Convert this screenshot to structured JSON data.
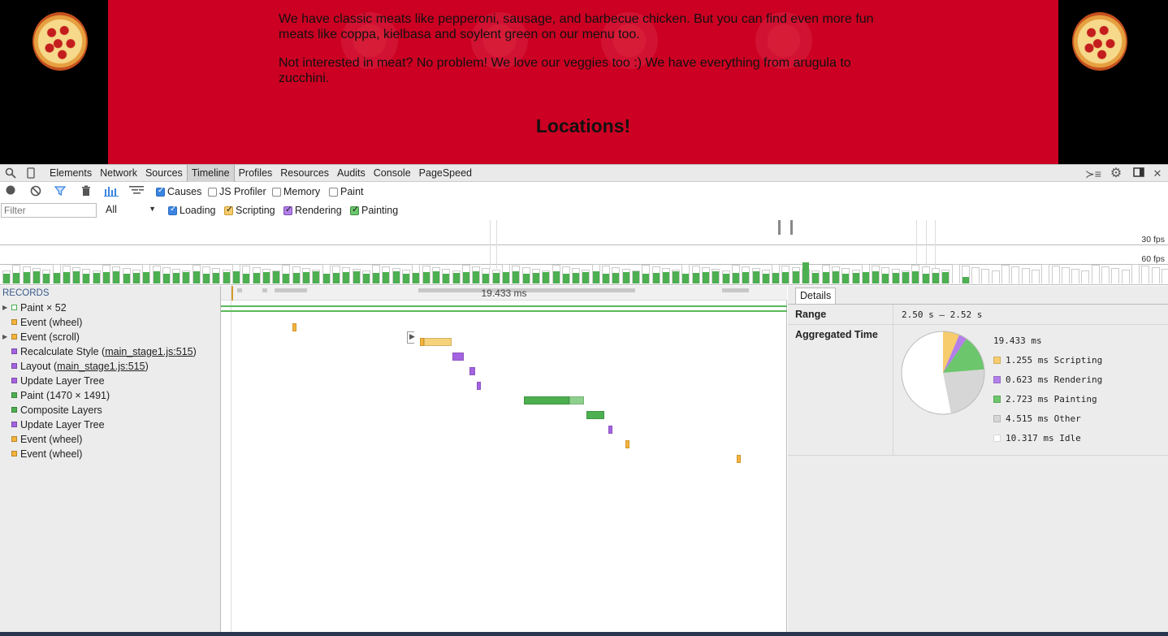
{
  "webpage": {
    "paragraph1": "We have classic meats like pepperoni, sausage, and barbecue chicken. But you can find even more fun meats like coppa, kielbasa and soylent green on our menu too.",
    "paragraph2": "Not interested in meat? No problem! We love our veggies too :) We have everything from arugula to zucchini.",
    "heading": "Locations!"
  },
  "devtools": {
    "tabs": [
      "Elements",
      "Network",
      "Sources",
      "Timeline",
      "Profiles",
      "Resources",
      "Audits",
      "Console",
      "PageSpeed"
    ],
    "selected_tab": "Timeline",
    "toolbar": {
      "causes": "Causes",
      "js_profiler": "JS Profiler",
      "memory": "Memory",
      "paint": "Paint"
    },
    "filter_placeholder": "Filter",
    "level": "All",
    "categories": {
      "loading": "Loading",
      "scripting": "Scripting",
      "rendering": "Rendering",
      "painting": "Painting"
    },
    "fps_30": "30 fps",
    "fps_60": "60 fps",
    "records_header": "RECORDS",
    "records": [
      {
        "label": "Paint × 52",
        "color": "#ffffff",
        "border": "#4caf50",
        "expandable": true
      },
      {
        "label": "Event (wheel)",
        "color": "#f5b33a",
        "expandable": false
      },
      {
        "label": "Event (scroll)",
        "color": "#f5b33a",
        "expandable": true
      },
      {
        "label": "Recalculate Style (",
        "link": "main_stage1.js:515",
        "suffix": ")",
        "color": "#a463e0",
        "expandable": false
      },
      {
        "label": "Layout (",
        "link": "main_stage1.js:515",
        "suffix": ")",
        "color": "#a463e0",
        "expandable": false
      },
      {
        "label": "Update Layer Tree",
        "color": "#a463e0",
        "expandable": false
      },
      {
        "label": "Paint (1470 × 1491)",
        "color": "#4caf50",
        "expandable": false
      },
      {
        "label": "Composite Layers",
        "color": "#4caf50",
        "expandable": false
      },
      {
        "label": "Update Layer Tree",
        "color": "#a463e0",
        "expandable": false
      },
      {
        "label": "Event (wheel)",
        "color": "#f5b33a",
        "expandable": false
      },
      {
        "label": "Event (wheel)",
        "color": "#f5b33a",
        "expandable": false
      }
    ],
    "ruler_label": "19.433 ms",
    "details": {
      "tab": "Details",
      "range_label": "Range",
      "range_value": "2.50 s – 2.52 s",
      "aggregated_label": "Aggregated Time",
      "total": "19.433 ms",
      "legend": [
        {
          "label": "1.255 ms Scripting",
          "color": "#f6cc6d"
        },
        {
          "label": "0.623 ms Rendering",
          "color": "#b37fe9"
        },
        {
          "label": "2.723 ms Painting",
          "color": "#6cc66c"
        },
        {
          "label": "4.515 ms Other",
          "color": "#d6d6d6"
        },
        {
          "label": "10.317 ms Idle",
          "color": "#ffffff"
        }
      ]
    }
  },
  "chart_data": {
    "type": "pie",
    "title": "",
    "categories": [
      "Scripting",
      "Rendering",
      "Painting",
      "Other",
      "Idle"
    ],
    "values": [
      1.255,
      0.623,
      2.723,
      4.515,
      10.317
    ],
    "colors": [
      "#f6cc6d",
      "#b37fe9",
      "#6cc66c",
      "#d6d6d6",
      "#ffffff"
    ]
  }
}
